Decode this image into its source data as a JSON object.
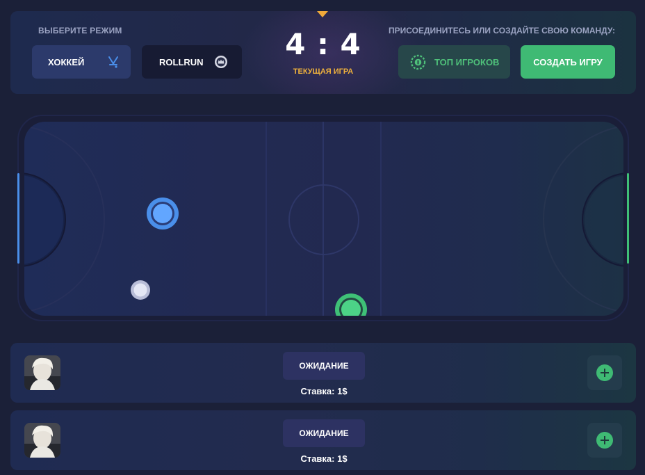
{
  "header": {
    "mode_label": "ВЫБЕРИТЕ РЕЖИМ",
    "modes": [
      {
        "label": "ХОККЕЙ",
        "icon": "hockey-sticks-icon",
        "active": true
      },
      {
        "label": "ROLLRUN",
        "icon": "crown-coin-icon",
        "active": false
      }
    ],
    "score": "4 : 4",
    "score_caption": "ТЕКУЩАЯ ИГРА",
    "join_label": "ПРИСОЕДИНИТЕСЬ ИЛИ СОЗДАЙТЕ СВОЮ КОМАНДУ:",
    "top_players_label": "ТОП ИГРОКОВ",
    "create_game_label": "СОЗДАТЬ ИГРУ"
  },
  "colors": {
    "background": "#1b2038",
    "team_blue": "#4a8fea",
    "team_green": "#3fc077",
    "accent_orange": "#f0b23c",
    "create_button": "#3fba74"
  },
  "rink": {
    "players": [
      {
        "team": "blue",
        "icon": "blue-player-puck"
      },
      {
        "team": "green",
        "icon": "green-player-puck"
      }
    ],
    "puck": {
      "icon": "puck-white"
    }
  },
  "games": [
    {
      "status": "ОЖИДАНИЕ",
      "bet": "Ставка: 1$",
      "join_icon": "plus-icon"
    },
    {
      "status": "ОЖИДАНИЕ",
      "bet": "Ставка: 1$",
      "join_icon": "plus-icon"
    }
  ]
}
